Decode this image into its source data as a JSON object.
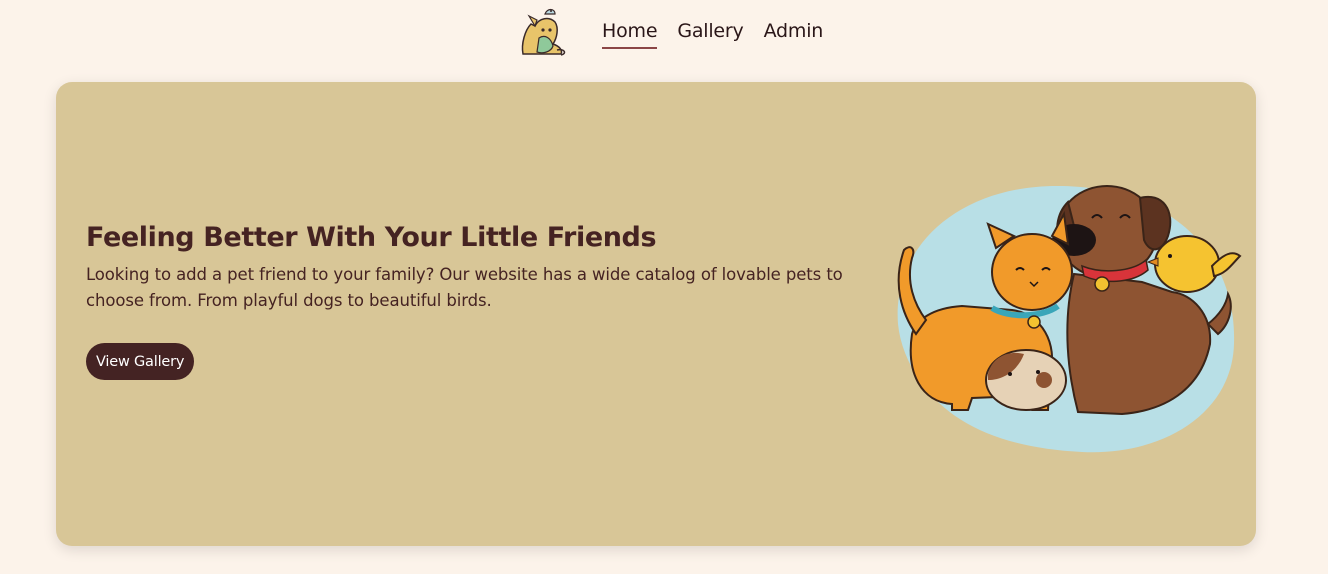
{
  "nav": {
    "logo_icon": "pet-shop-logo-icon",
    "links": [
      {
        "label": "Home",
        "active": true
      },
      {
        "label": "Gallery",
        "active": false
      },
      {
        "label": "Admin",
        "active": false
      }
    ]
  },
  "hero": {
    "title": "Feeling Better With Your Little Friends",
    "text": "Looking to add a pet friend to your family? Our website has a wide catalog of lovable pets to choose from. From playful dogs to beautiful birds.",
    "button_label": "View Gallery",
    "illustration": "pets-illustration"
  },
  "colors": {
    "page_bg": "#fcf3ea",
    "hero_bg": "#d8c697",
    "text_dark": "#452322",
    "button_bg": "#442323",
    "active_underline": "#8b4545"
  }
}
